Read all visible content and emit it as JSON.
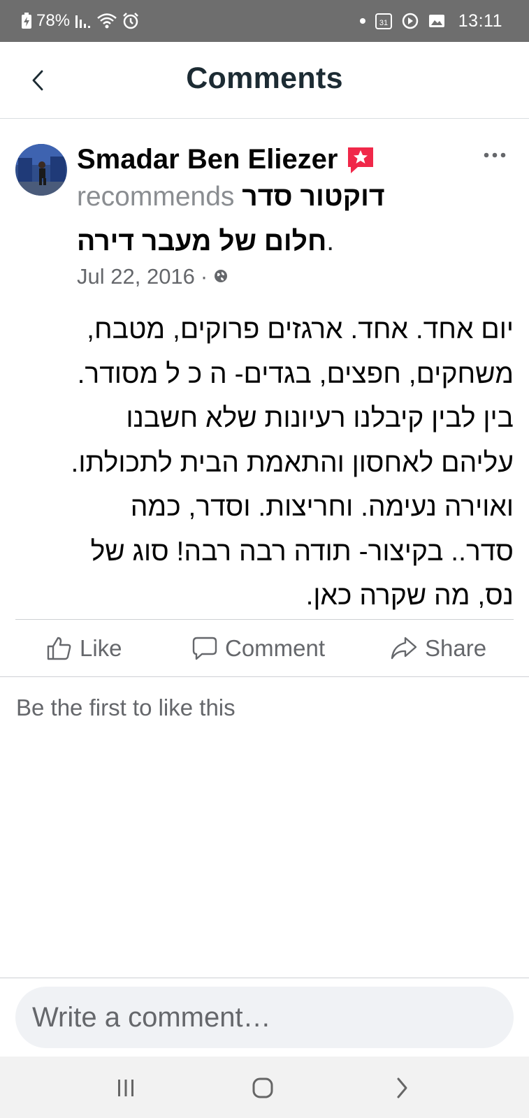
{
  "status_bar": {
    "battery": "78%",
    "calendar_day": "31",
    "time": "13:11"
  },
  "header": {
    "title": "Comments"
  },
  "post": {
    "author": "Smadar Ben Eliezer",
    "recommends_word": "recommends",
    "page_name_part1": "דוקטור סדר",
    "page_name_part2": "חלום של מעבר דירה",
    "period": ".",
    "date": "Jul 22, 2016",
    "date_separator": "·",
    "body_lines": [
      "יום אחד. אחד. ארגזים פרוקים, מטבח,",
      "משחקים, חפצים, בגדים- ה כ ל מסודר.",
      "בין לבין קיבלנו רעיונות שלא חשבנו",
      "עליהם לאחסון והתאמת הבית לתכולתו.",
      "ואוירה נעימה. וחריצות. וסדר, כמה",
      "סדר.. בקיצור- תודה רבה רבה! סוג של",
      "נס, מה שקרה כאן."
    ]
  },
  "actions": {
    "like": "Like",
    "comment": "Comment",
    "share": "Share"
  },
  "reactions_text": "Be the first to like this",
  "composer": {
    "placeholder": "Write a comment…"
  },
  "colors": {
    "status_bar_bg": "#6e6e6e",
    "recommend_badge": "#f02849",
    "secondary_text": "#65676b",
    "input_bg": "#f0f2f5"
  }
}
